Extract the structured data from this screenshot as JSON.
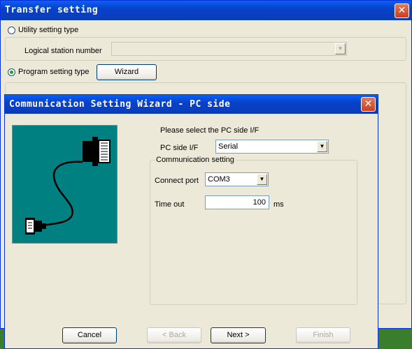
{
  "transfer_window": {
    "title": "Transfer setting",
    "close_glyph": "✕",
    "utility_option": {
      "label": "Utility setting type",
      "selected": false
    },
    "logical_station": {
      "label": "Logical station number",
      "value": ""
    },
    "program_option": {
      "label": "Program setting type",
      "selected": true
    },
    "wizard_button": "Wizard"
  },
  "wizard": {
    "title": "Communication Setting Wizard - PC side",
    "close_glyph": "✕",
    "picture_icon": "serial-cable-icon",
    "prompt": "Please select the PC side I/F",
    "pc_side_if": {
      "label": "PC side I/F",
      "value": "Serial"
    },
    "group_title": "Communication setting",
    "connect_port": {
      "label": "Connect port",
      "value": "COM3"
    },
    "time_out": {
      "label": "Time out",
      "value": "100",
      "unit": "ms"
    },
    "buttons": {
      "cancel": "Cancel",
      "back": "< Back",
      "next": "Next >",
      "finish": "Finish"
    }
  },
  "colors": {
    "titlebar_blue": "#0842c9",
    "window_bg": "#ece9d8",
    "picture_bg": "#008080",
    "desktop_green": "#3a7d2c"
  }
}
